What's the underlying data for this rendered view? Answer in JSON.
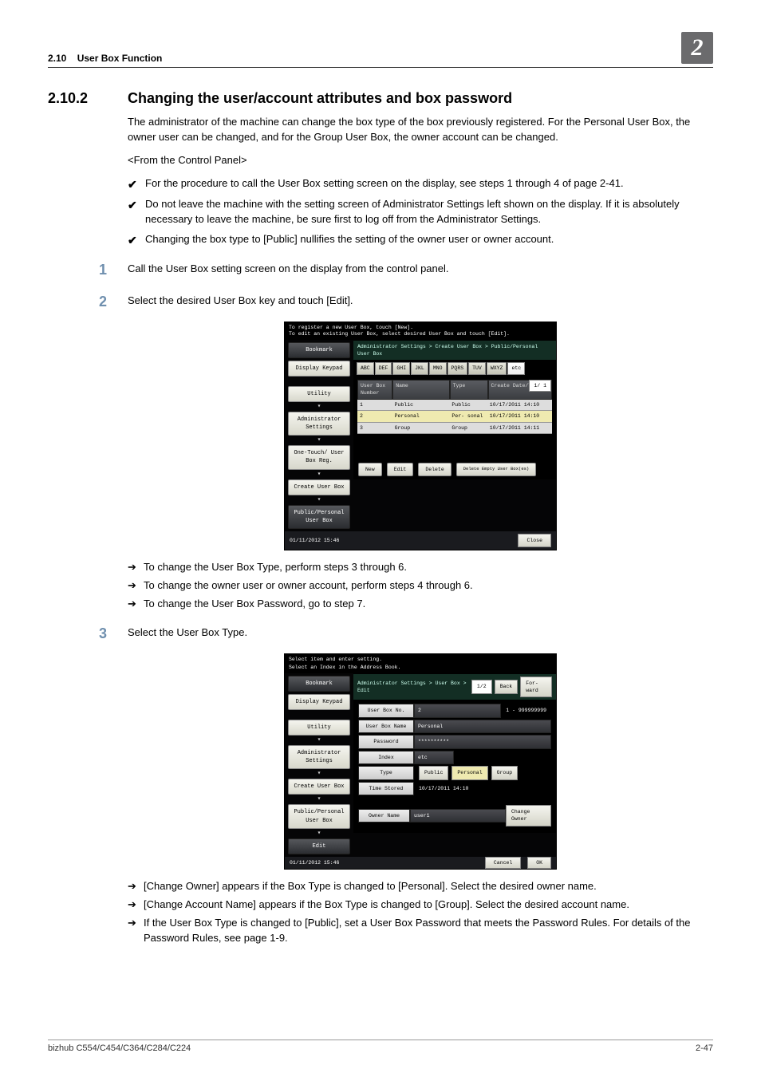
{
  "header": {
    "section_num": "2.10",
    "section_name": "User Box Function",
    "corner_num": "2"
  },
  "title": {
    "num": "2.10.2",
    "text": "Changing the user/account attributes and box password"
  },
  "intro_para": "The administrator of the machine can change the box type of the box previously registered. For the Personal User Box, the owner user can be changed, and for the Group User Box, the owner account can be changed.",
  "from_cp": "<From the Control Panel>",
  "bullets": [
    "For the procedure to call the User Box setting screen on the display, see steps 1 through 4 of page 2-41.",
    "Do not leave the machine with the setting screen of Administrator Settings left shown on the display. If it is absolutely necessary to leave the machine, be sure first to log off from the Administrator Settings.",
    "Changing the box type to [Public] nullifies the setting of the owner user or owner account."
  ],
  "steps": {
    "s1": "Call the User Box setting screen on the display from the control panel.",
    "s2": "Select the desired User Box key and touch [Edit].",
    "s3": "Select the User Box Type."
  },
  "arrows_after_shot1": [
    "To change the User Box Type, perform steps 3 through 6.",
    "To change the owner user or owner account, perform steps 4 through 6.",
    "To change the User Box Password, go to step 7."
  ],
  "arrows_after_shot2": [
    "[Change Owner] appears if the Box Type is changed to [Personal]. Select the desired owner name.",
    "[Change Account Name] appears if the Box Type is changed to [Group]. Select the desired account name.",
    "If the User Box Type is changed to [Public], set a User Box Password that meets the Password Rules. For details of the Password Rules, see page 1-9."
  ],
  "shot1": {
    "top1": "To register a new User Box, touch [New].",
    "top2": "To edit an existing User Box, select desired User Box and touch [Edit].",
    "crumb": "Administrator Settings > Create User Box > Public/Personal User Box",
    "side": [
      "Bookmark",
      "Display Keypad",
      "Utility",
      "Administrator Settings",
      "One-Touch/ User Box Reg.",
      "Create User Box",
      "Public/Personal User Box"
    ],
    "tabs": [
      "ABC",
      "DEF",
      "GHI",
      "JKL",
      "MNO",
      "PQRS",
      "TUV",
      "WXYZ",
      "etc"
    ],
    "head": [
      "User Box Number",
      "Name",
      "Type",
      "Create Date/Time"
    ],
    "rows": [
      {
        "num": "1",
        "name": "Public",
        "type": "Public",
        "date": "10/17/2011 14:10"
      },
      {
        "num": "2",
        "name": "Personal",
        "type": "Per- sonal",
        "date": "10/17/2011 14:10"
      },
      {
        "num": "3",
        "name": "Group",
        "type": "Group",
        "date": "10/17/2011 14:11"
      }
    ],
    "page_ind": "1/  1",
    "btns": [
      "New",
      "Edit",
      "Delete",
      "Delete Empty User Box(es)"
    ],
    "foot_date": "01/11/2012   15:46",
    "close": "Close"
  },
  "shot2": {
    "top1": "Select item and enter setting.",
    "top2": "Select an Index in the Address Book.",
    "crumb": "Administrator Settings > User Box > Edit",
    "nav": {
      "page": "1/2",
      "back": "Back",
      "fwd": "For- ward"
    },
    "side": [
      "Bookmark",
      "Display Keypad",
      "Utility",
      "Administrator Settings",
      "Create User Box",
      "Public/Personal User Box",
      "Edit"
    ],
    "fields": {
      "box_no_lbl": "User Box No.",
      "box_no_val": "2",
      "box_no_range": "1 - 999999999",
      "box_name_lbl": "User Box Name",
      "box_name_val": "Personal",
      "pw_lbl": "Password",
      "pw_val": "**********",
      "index_lbl": "Index",
      "index_val": "etc",
      "type_lbl": "Type",
      "type_opts": [
        "Public",
        "Personal",
        "Group"
      ],
      "type_sel": "Personal",
      "time_lbl": "Time Stored",
      "time_val": "10/17/2011   14:10",
      "owner_lbl": "Owner Name",
      "owner_val": "user1",
      "change_owner": "Change Owner"
    },
    "foot_date": "01/11/2012   15:46",
    "cancel": "Cancel",
    "ok": "OK"
  },
  "footer": {
    "left": "bizhub C554/C454/C364/C284/C224",
    "right": "2-47"
  }
}
